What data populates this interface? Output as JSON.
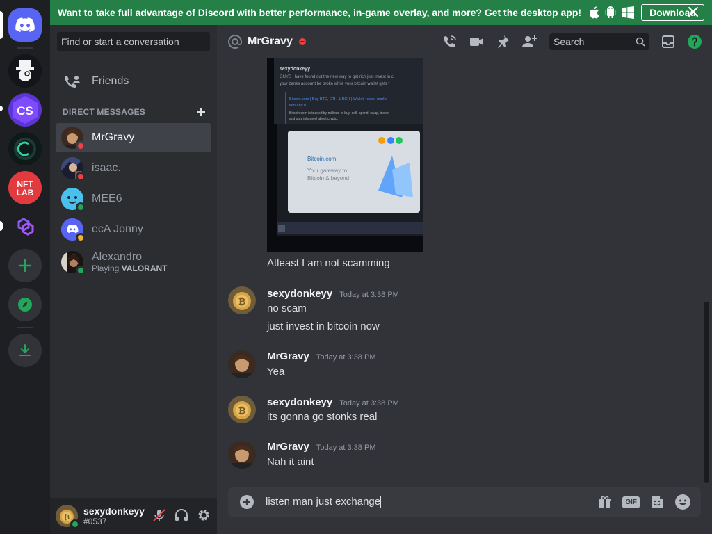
{
  "banner": {
    "text": "Want to take full advantage of Discord with better performance, in-game overlay, and more? Get the desktop app!",
    "download_label": "Download"
  },
  "servers": [
    {
      "name": "home",
      "icon": "discord-logo-icon"
    },
    {
      "name": "monopoly-man",
      "icon": "monocle-man-icon"
    },
    {
      "name": "cs",
      "initials": "CS"
    },
    {
      "name": "c-coin",
      "icon": "c-ring-icon"
    },
    {
      "name": "nft-lab",
      "initials": "NFT LAB"
    },
    {
      "name": "polygon",
      "icon": "polygon-icon"
    }
  ],
  "dm_sidebar": {
    "search_placeholder": "Find or start a conversation",
    "friends_label": "Friends",
    "direct_messages_label": "DIRECT MESSAGES",
    "items": [
      {
        "name": "MrGravy",
        "status": "dnd",
        "active": true
      },
      {
        "name": "isaac.",
        "status": "dnd"
      },
      {
        "name": "MEE6",
        "status": "online"
      },
      {
        "name": "ecA Jonny",
        "status": "idle"
      },
      {
        "name": "Alexandro",
        "status": "online",
        "activity_prefix": "Playing ",
        "activity": "VALORANT"
      }
    ]
  },
  "user_panel": {
    "username": "sexydonkeyy",
    "tag": "#0537"
  },
  "chat_header": {
    "name": "MrGravy",
    "search_placeholder": "Search"
  },
  "attachment": {
    "author_line": "sexydonkeyy",
    "caption_line1": "GUYS i have found out the new way to get rich just invest in c",
    "caption_line2": "your banks account be broke while your bitcoin wallet gets f",
    "link_title": "Bitcoin.com | Buy BTC, ETH & BCH | Wallet, news, marke",
    "link_title2": "info and n...",
    "link_desc": "Bitcoin.com is trusted by millions to buy, sell, spend, swap, invest",
    "link_desc2": "and stay informed about crypto.",
    "site_logo": "Bitcoin.com",
    "site_tagline1": "Your gateway to",
    "site_tagline2": "Bitcoin & beyond"
  },
  "messages": [
    {
      "type": "continuation",
      "text": "Atleast I am not scamming"
    },
    {
      "type": "group",
      "author": "sexydonkeyy",
      "timestamp": "Today at 3:38 PM",
      "lines": [
        "no scam",
        "just invest in bitcoin now"
      ]
    },
    {
      "type": "group",
      "author": "MrGravy",
      "timestamp": "Today at 3:38 PM",
      "lines": [
        "Yea"
      ]
    },
    {
      "type": "group",
      "author": "sexydonkeyy",
      "timestamp": "Today at 3:38 PM",
      "lines": [
        "its gonna go stonks real"
      ]
    },
    {
      "type": "group",
      "author": "MrGravy",
      "timestamp": "Today at 3:38 PM",
      "lines": [
        "Nah it aint"
      ]
    }
  ],
  "composer": {
    "value": "listen man just exchange",
    "gif_label": "GIF"
  },
  "colors": {
    "blurple": "#5865f2",
    "online": "#23a55a",
    "dnd": "#f23f43",
    "idle": "#f0b232",
    "banner": "#248046"
  }
}
